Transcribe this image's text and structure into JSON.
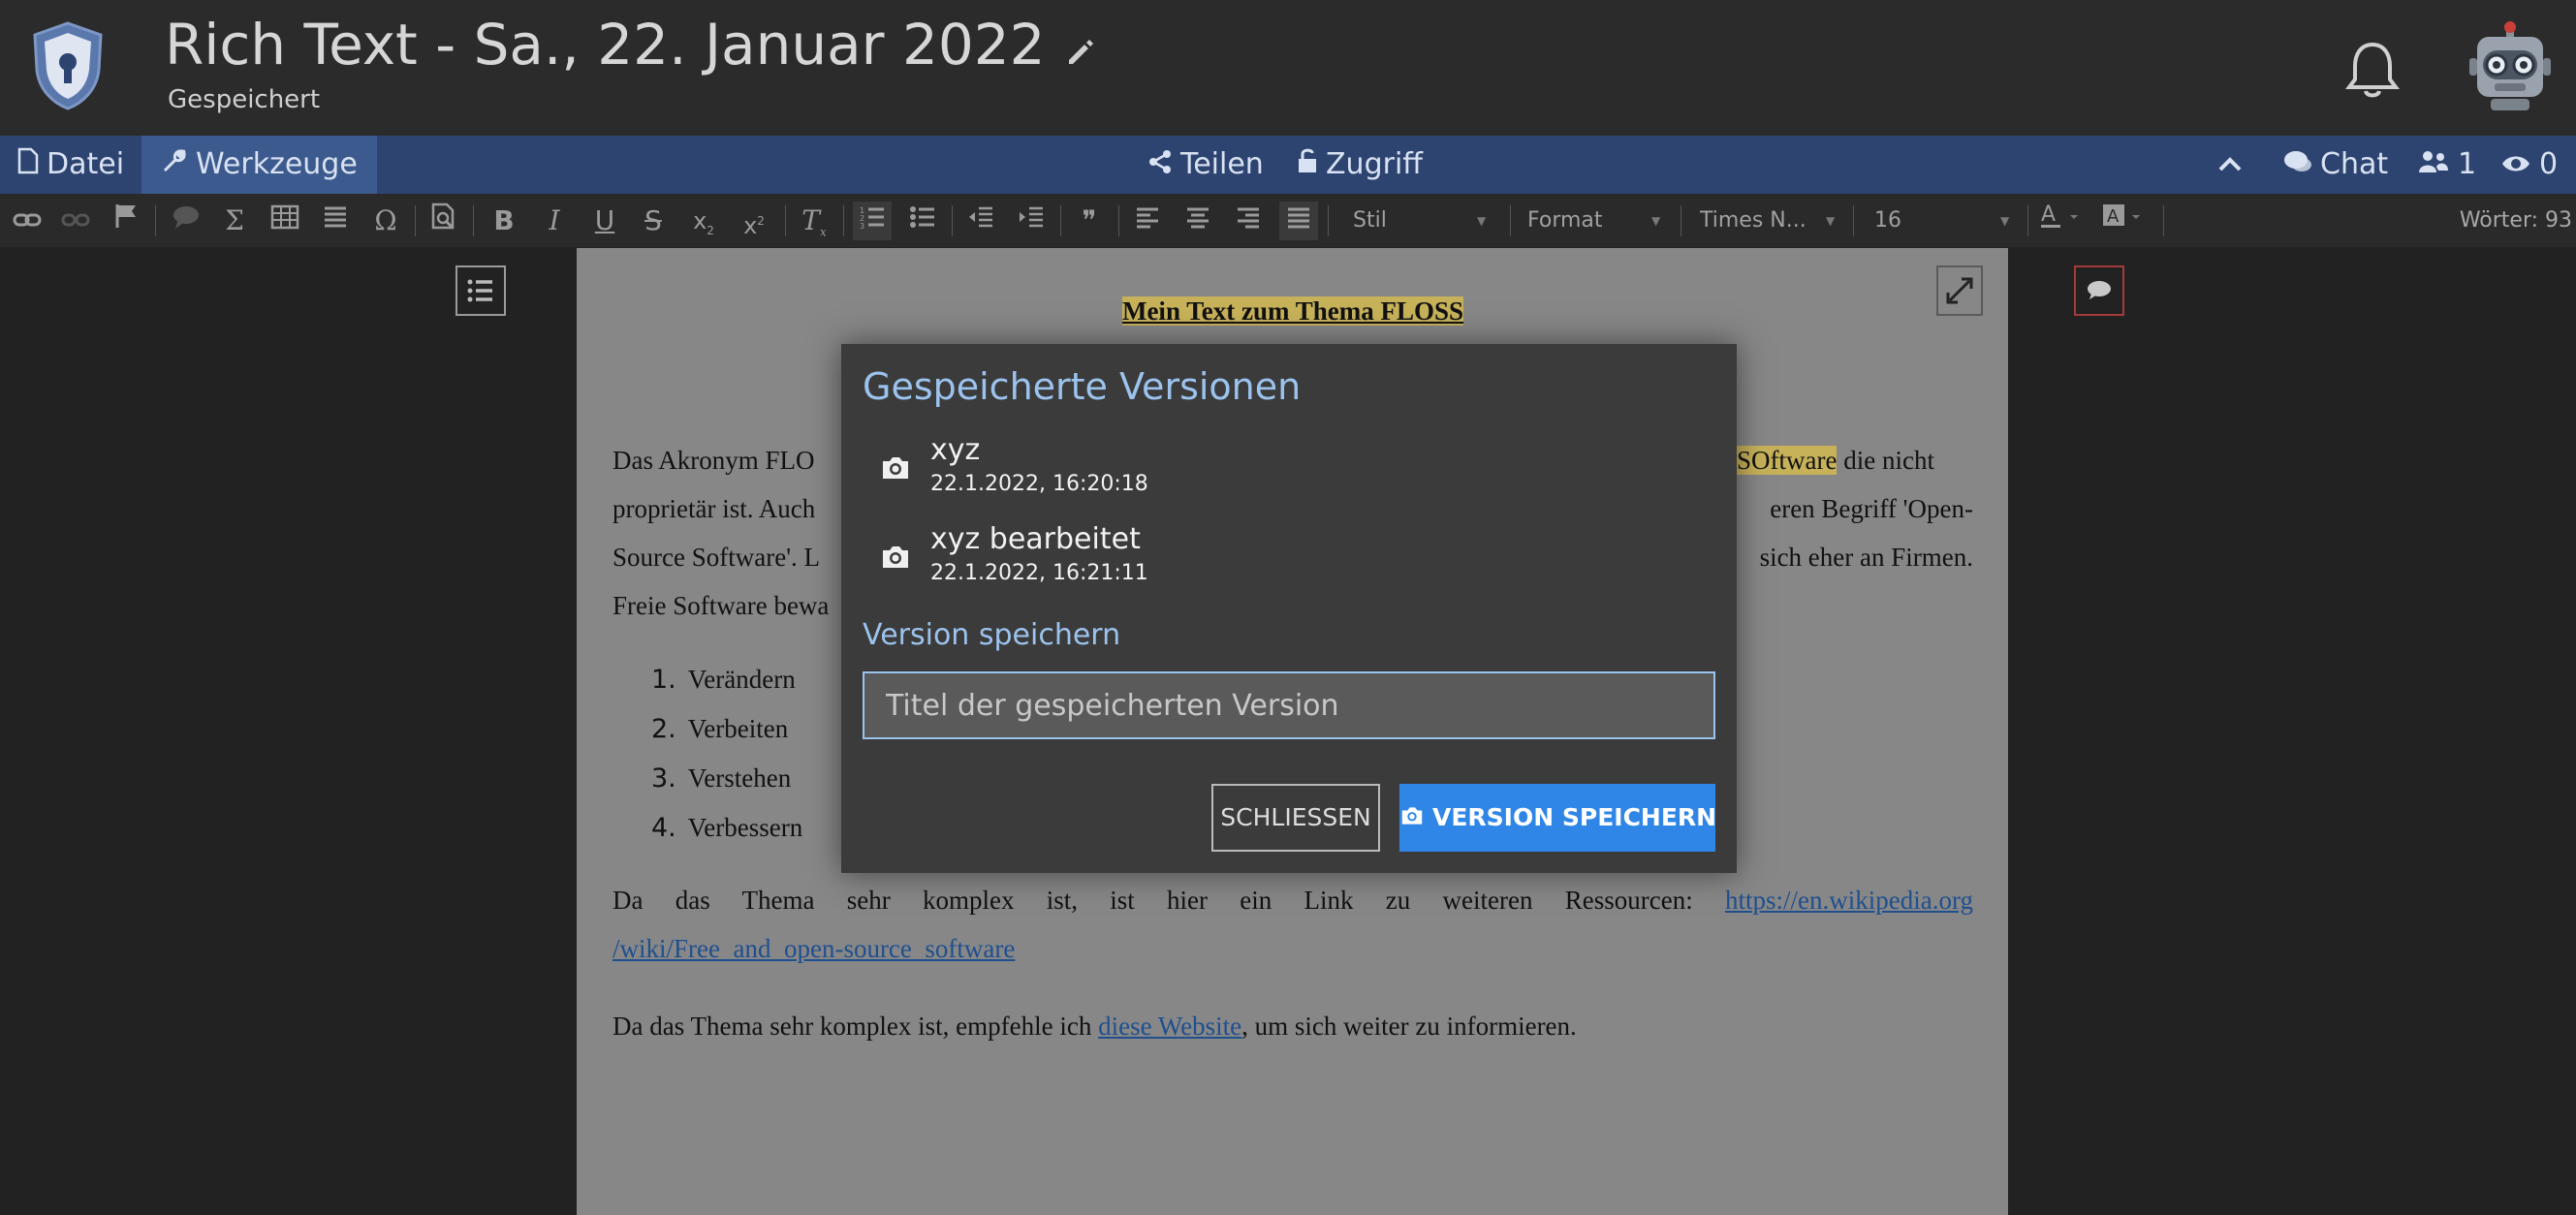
{
  "header": {
    "title": "Rich Text - Sa., 22. Januar 2022",
    "status": "Gespeichert"
  },
  "menu": {
    "file": "Datei",
    "tools": "Werkzeuge",
    "share": "Teilen",
    "access": "Zugriff",
    "chat": "Chat",
    "users_count": "1",
    "viewers_count": "0"
  },
  "toolbar": {
    "style_select": "Stil",
    "format_select": "Format",
    "font_select": "Times N...",
    "size_select": "16",
    "word_count": "Wörter: 93",
    "buttons": {
      "bold": "B",
      "italic": "I",
      "underline": "U",
      "strike": "S",
      "subscript": "x",
      "superscript": "x",
      "clear_format": "T",
      "omega": "Ω",
      "sigma": "Σ",
      "quote": "❞"
    }
  },
  "document": {
    "heading": "Mein Text zum Thema FLOSS",
    "para1_line1_a": "Das Akronym FLO",
    "para1_line1_b": "SOftware",
    "para1_line1_c": " die nicht",
    "para1_line2_a": "proprietär ist. Auch",
    "para1_line2_b": "eren Begriff 'Open-",
    "para1_line3_a": "Source Software'. L",
    "para1_line3_b": "sich eher an Firmen.",
    "para1_line4_a": "Freie Software bewa",
    "list": [
      {
        "num": "1.",
        "text": "Verändern"
      },
      {
        "num": "2.",
        "text": "Verbeiten"
      },
      {
        "num": "3.",
        "text": "Verstehen"
      },
      {
        "num": "4.",
        "text": "Verbessern"
      }
    ],
    "para2_text": "Da das Thema sehr komplex ist, ist hier ein Link zu weiteren Ressourcen: ",
    "para2_link_a": "https://en.wikipedia.org",
    "para2_link_b": "/wiki/Free_and_open-source_software",
    "para3_text_a": "Da das Thema sehr komplex ist, empfehle ich ",
    "para3_link": "diese Website",
    "para3_text_b": ", um sich weiter zu informieren."
  },
  "modal": {
    "title": "Gespeicherte Versionen",
    "versions": [
      {
        "name": "xyz",
        "date": "22.1.2022, 16:20:18"
      },
      {
        "name": "xyz bearbeitet",
        "date": "22.1.2022, 16:21:11"
      }
    ],
    "save_section_label": "Version speichern",
    "input_placeholder": "Titel der gespeicherten Version",
    "input_value": "",
    "close_button": "SCHLIESSEN",
    "save_button": "VERSION SPEICHERN"
  },
  "colors": {
    "accent": "#2f86e6",
    "modal_heading": "#9cc3ee",
    "menubar": "#2e4470",
    "highlight": "#c7b25a"
  }
}
